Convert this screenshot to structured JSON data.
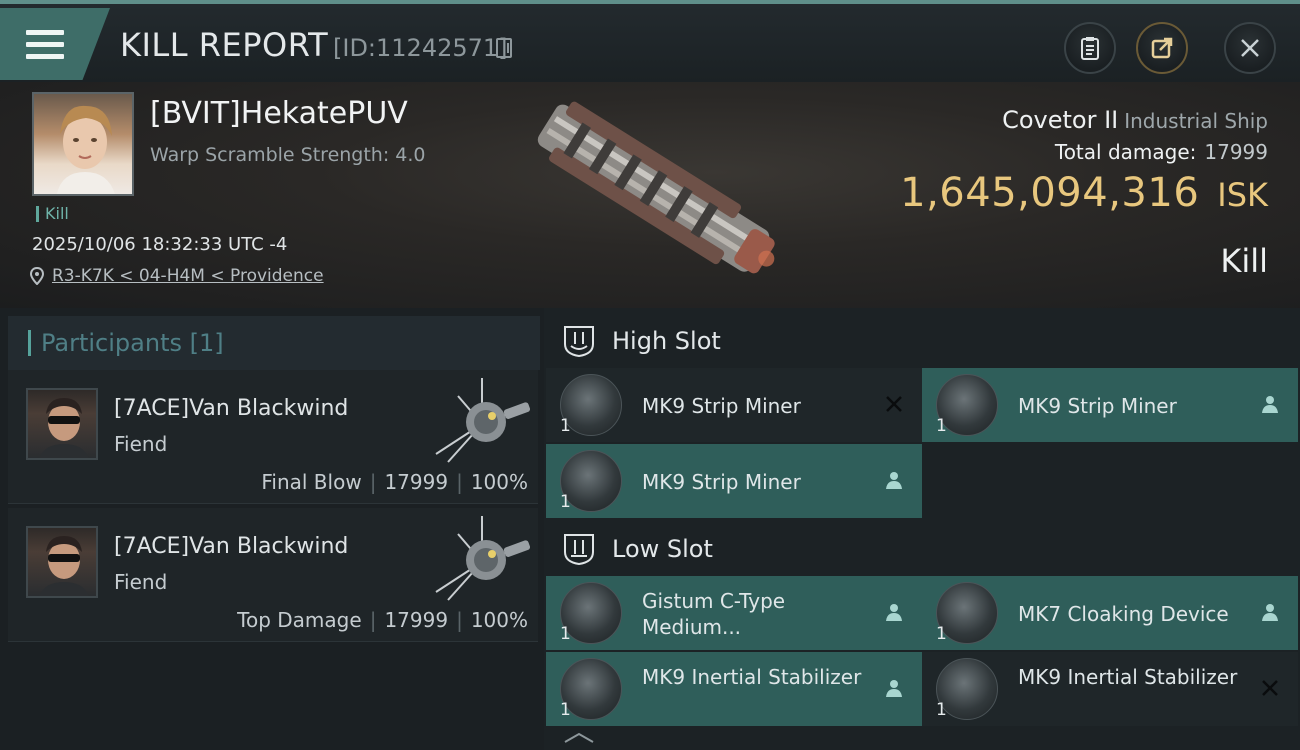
{
  "header": {
    "title": "KILL REPORT",
    "kill_id": "[ID:11242571]",
    "icons": [
      "menu-icon",
      "copy-icon",
      "clipboard-icon",
      "share-icon",
      "close-icon"
    ]
  },
  "victim": {
    "name": "[BVIT]HekatePUV",
    "warp_scramble": "Warp Scramble Strength: 4.0",
    "tag": "Kill",
    "timestamp": "2025/10/06 18:32:33 UTC -4",
    "location": "R3-K7K < 04-H4M < Providence"
  },
  "ship": {
    "name": "Covetor II",
    "class": "Industrial Ship",
    "damage_label": "Total damage:",
    "damage_value": "17999",
    "isk_value": "1,645,094,316",
    "isk_unit": "ISK",
    "outcome": "Kill"
  },
  "participants": {
    "header": "Participants [1]",
    "rows": [
      {
        "name": "[7ACE]Van Blackwind",
        "ship": "Fiend",
        "role": "Final Blow",
        "damage": "17999",
        "percent": "100%"
      },
      {
        "name": "[7ACE]Van Blackwind",
        "ship": "Fiend",
        "role": "Top Damage",
        "damage": "17999",
        "percent": "100%"
      }
    ]
  },
  "fitting": {
    "high_slot_label": "High Slot",
    "low_slot_label": "Low Slot",
    "high_items": [
      {
        "name": "MK9 Strip Miner",
        "qty": "1",
        "status": "destroyed"
      },
      {
        "name": "MK9 Strip Miner",
        "qty": "1",
        "status": "dropped"
      },
      {
        "name": "MK9 Strip Miner",
        "qty": "1",
        "status": "dropped"
      }
    ],
    "low_items": [
      {
        "name": "Gistum C-Type Medium...",
        "qty": "1",
        "status": "dropped"
      },
      {
        "name": "MK7 Cloaking Device",
        "qty": "1",
        "status": "dropped"
      },
      {
        "name": "MK9 Inertial Stabilizer",
        "qty": "1",
        "status": "dropped"
      },
      {
        "name": "MK9 Inertial Stabilizer",
        "qty": "1",
        "status": "destroyed"
      }
    ]
  },
  "colors": {
    "accent_teal": "#2f5e5a",
    "isk_gold": "#e8c77e",
    "muted_teal_text": "#4f7f86"
  }
}
